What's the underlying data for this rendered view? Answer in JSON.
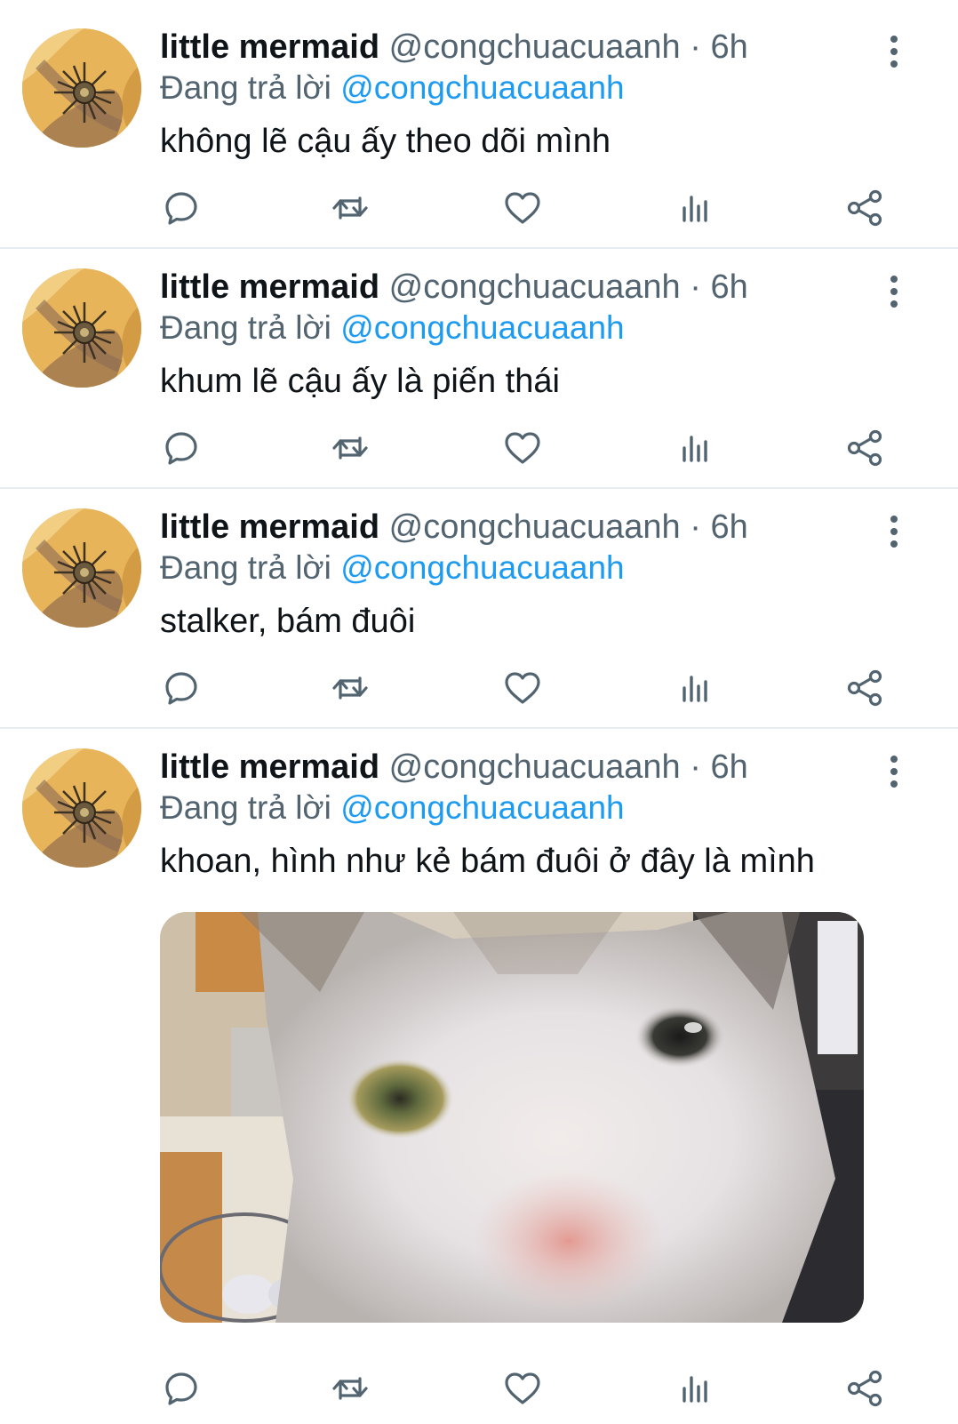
{
  "tweets": [
    {
      "name": "little mermaid",
      "handle": "@congchuacuaanh",
      "separator": "·",
      "time": "6h",
      "reply_prefix": "Đang trả lời",
      "reply_to": "@congchuacuaanh",
      "text": "không lẽ cậu ấy theo dõi mình"
    },
    {
      "name": "little mermaid",
      "handle": "@congchuacuaanh",
      "separator": "·",
      "time": "6h",
      "reply_prefix": "Đang trả lời",
      "reply_to": "@congchuacuaanh",
      "text": "khum lẽ cậu ấy là piến thái"
    },
    {
      "name": "little mermaid",
      "handle": "@congchuacuaanh",
      "separator": "·",
      "time": "6h",
      "reply_prefix": "Đang trả lời",
      "reply_to": "@congchuacuaanh",
      "text": "stalker, bám đuôi"
    },
    {
      "name": "little mermaid",
      "handle": "@congchuacuaanh",
      "separator": "·",
      "time": "6h",
      "reply_prefix": "Đang trả lời",
      "reply_to": "@congchuacuaanh",
      "text": "khoan, hình như kẻ bám đuôi ở đây là mình",
      "media": "cat-closeup-photo"
    }
  ],
  "icons": {
    "reply": "reply-icon",
    "retweet": "retweet-icon",
    "like": "heart-icon",
    "stats": "analytics-icon",
    "share": "share-icon",
    "more": "more-vertical-icon"
  },
  "colors": {
    "text_primary": "#0f1419",
    "text_secondary": "#536471",
    "link": "#1d9bf0",
    "divider": "#e6ecf0"
  }
}
